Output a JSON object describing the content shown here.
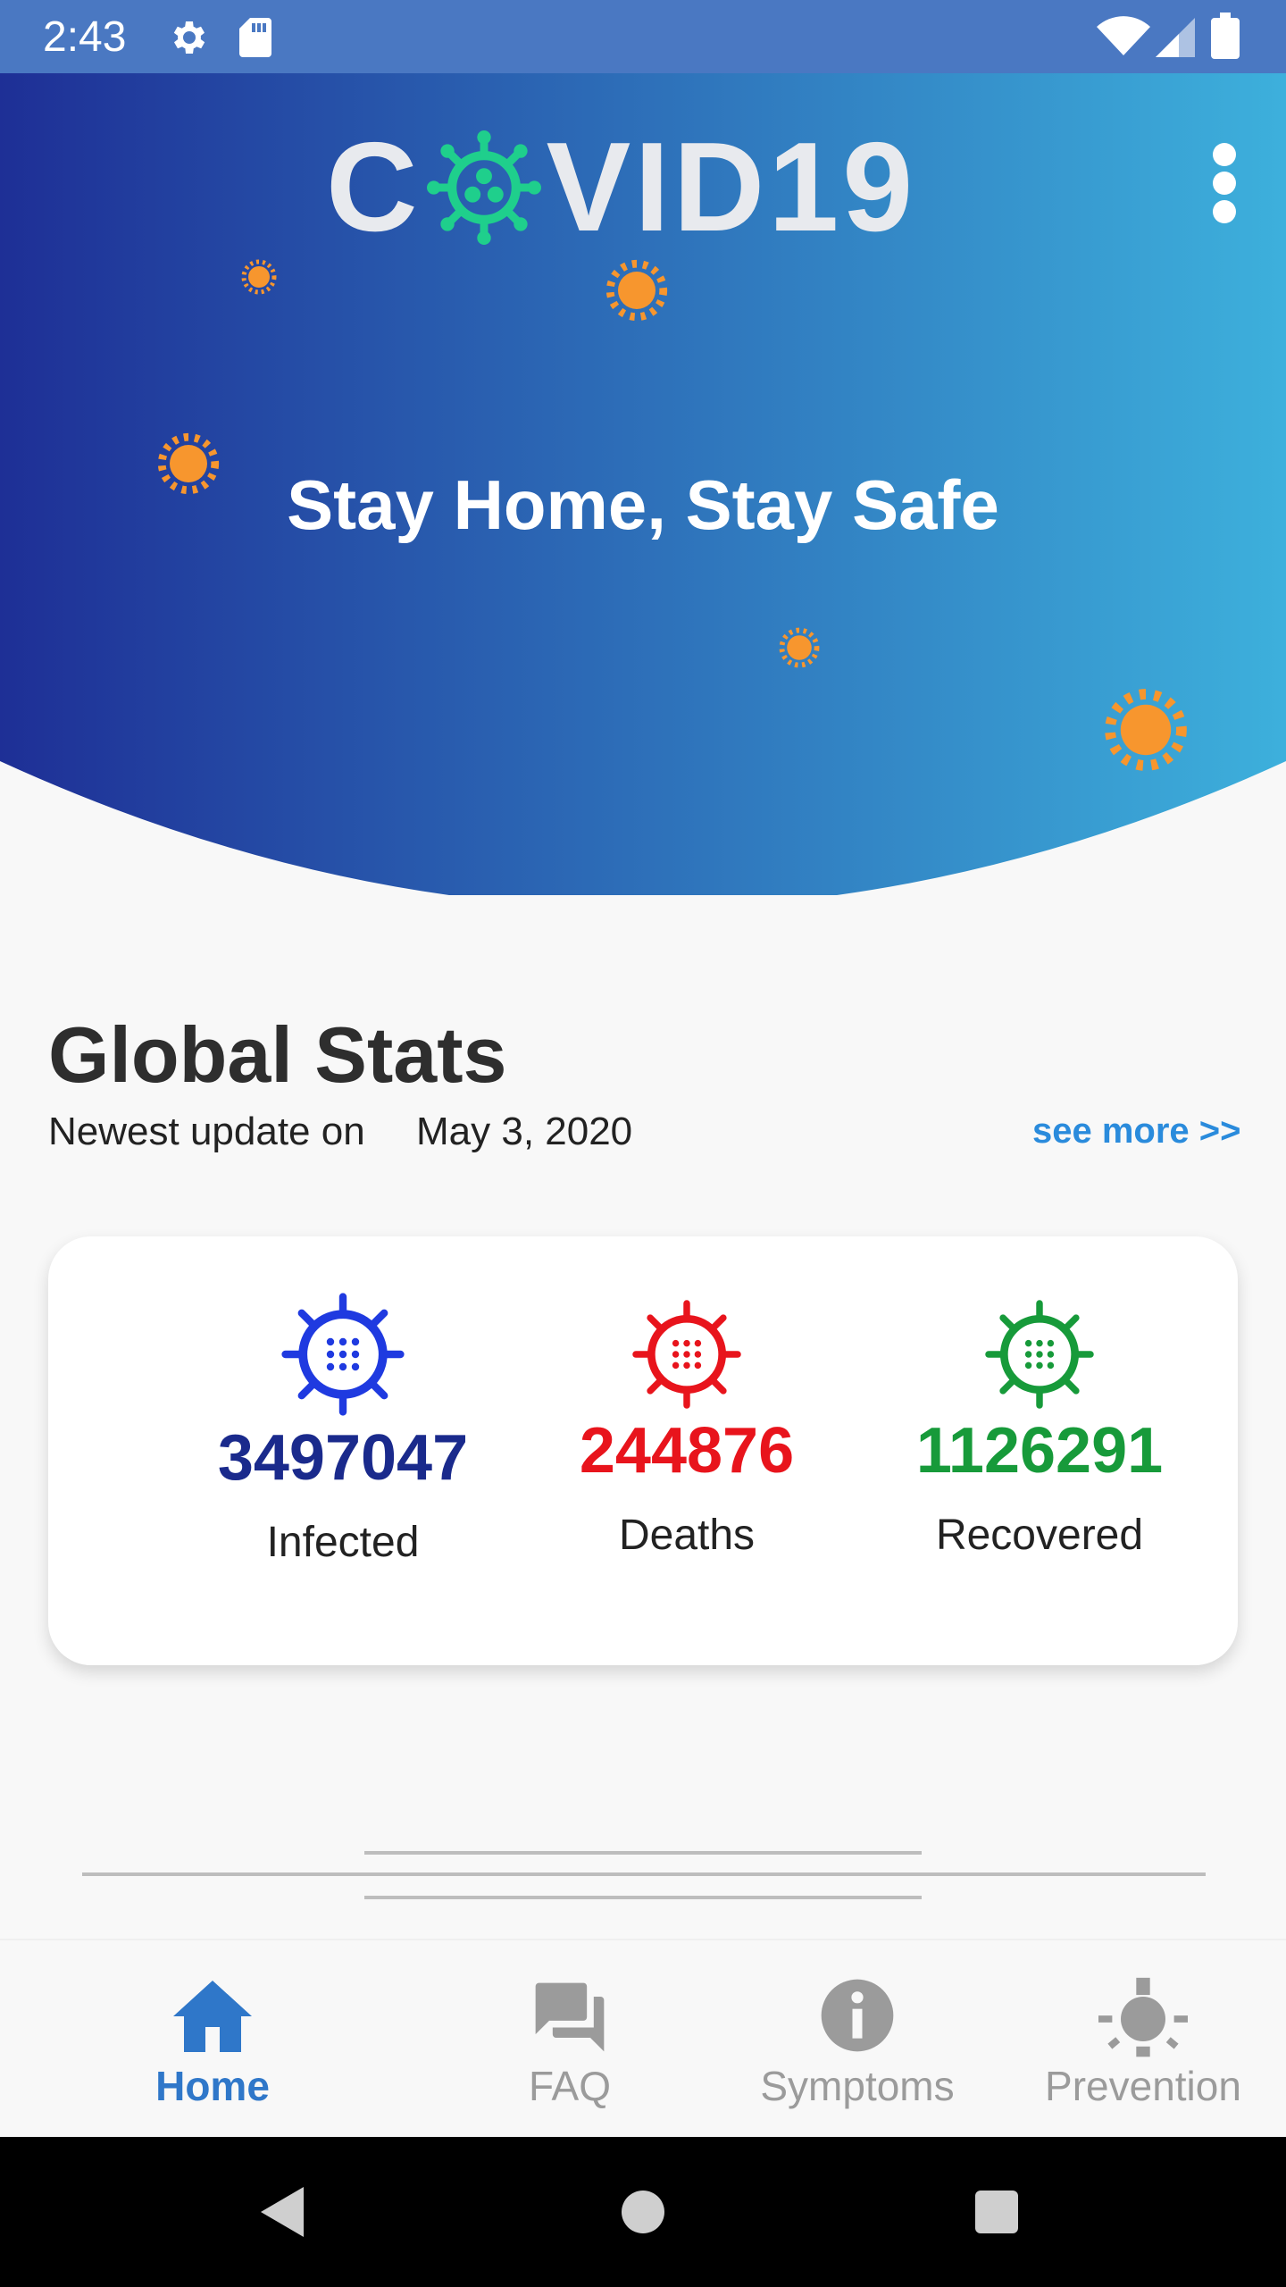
{
  "status_bar": {
    "time": "2:43"
  },
  "header": {
    "logo_text_left": "C",
    "logo_text_right": "VID19",
    "title": "Stay Home, Stay Safe",
    "gradient_start": "#1e2f96",
    "gradient_end": "#3db0dc"
  },
  "stats": {
    "title": "Global Stats",
    "update_label": "Newest update on",
    "update_date": "May 3, 2020",
    "see_more": "see more >>",
    "items": [
      {
        "value": "3497047",
        "label": "Infected",
        "color": "#1a2a8c",
        "icon_color": "#1f3ae0",
        "icon": "virus-icon"
      },
      {
        "value": "244876",
        "label": "Deaths",
        "color": "#e8141c",
        "icon_color": "#e8141c",
        "icon": "virus-icon"
      },
      {
        "value": "1126291",
        "label": "Recovered",
        "color": "#179a3a",
        "icon_color": "#179a3a",
        "icon": "virus-icon"
      }
    ]
  },
  "bottom_nav": {
    "items": [
      {
        "label": "Home",
        "icon": "home-icon",
        "active": true
      },
      {
        "label": "FAQ",
        "icon": "forum-icon",
        "active": false
      },
      {
        "label": "Symptoms",
        "icon": "info-icon",
        "active": false
      },
      {
        "label": "Prevention",
        "icon": "lightbulb-icon",
        "active": false
      }
    ],
    "active_color": "#2f77c9",
    "inactive_color": "#9b9b9b"
  }
}
